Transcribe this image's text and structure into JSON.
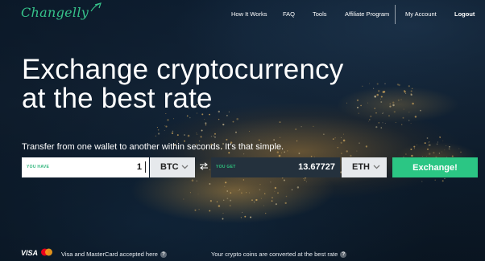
{
  "brand": {
    "name": "Changelly",
    "accent": "#36c28a"
  },
  "nav": {
    "items": [
      "How It Works",
      "FAQ",
      "Tools",
      "Affiliate Program"
    ],
    "account": "My Account",
    "logout": "Logout"
  },
  "hero": {
    "line1": "Exchange cryptocurrency",
    "line2_prefix": "at the ",
    "line2_bold": "best rate",
    "subtitle": "Transfer from one wallet to another within seconds. It's that simple."
  },
  "form": {
    "you_have_label": "YOU HAVE",
    "you_have_value": "1",
    "from_currency": "BTC",
    "you_get_label": "YOU GET",
    "you_get_value": "13.67727",
    "to_currency": "ETH",
    "exchange_label": "Exchange!",
    "button_color": "#2bc684"
  },
  "footer": {
    "visa_text": "VISA",
    "cards_note": "Visa and MasterCard accepted here",
    "rate_note": "Your crypto coins are converted at the best rate",
    "help_glyph": "?"
  }
}
